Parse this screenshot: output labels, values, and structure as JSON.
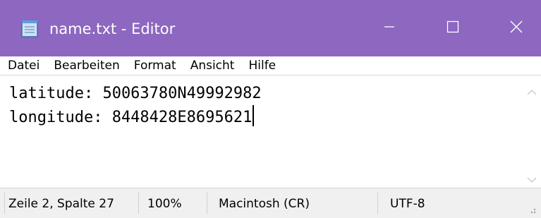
{
  "window": {
    "title": "name.txt - Editor",
    "icons": {
      "app": "notepad-icon",
      "minimize": "minimize-icon",
      "maximize": "maximize-icon",
      "close": "close-icon"
    },
    "colors": {
      "titlebar": "#8d67c0",
      "titlebar_text": "#ffffff"
    }
  },
  "menu": {
    "items": [
      "Datei",
      "Bearbeiten",
      "Format",
      "Ansicht",
      "Hilfe"
    ]
  },
  "editor": {
    "lines": [
      "latitude: 50063780N49992982",
      "longitude: 8448428E8695621"
    ]
  },
  "status": {
    "position": "Zeile 2, Spalte 27",
    "zoom": "100%",
    "line_ending": "Macintosh (CR)",
    "encoding": "UTF-8"
  }
}
